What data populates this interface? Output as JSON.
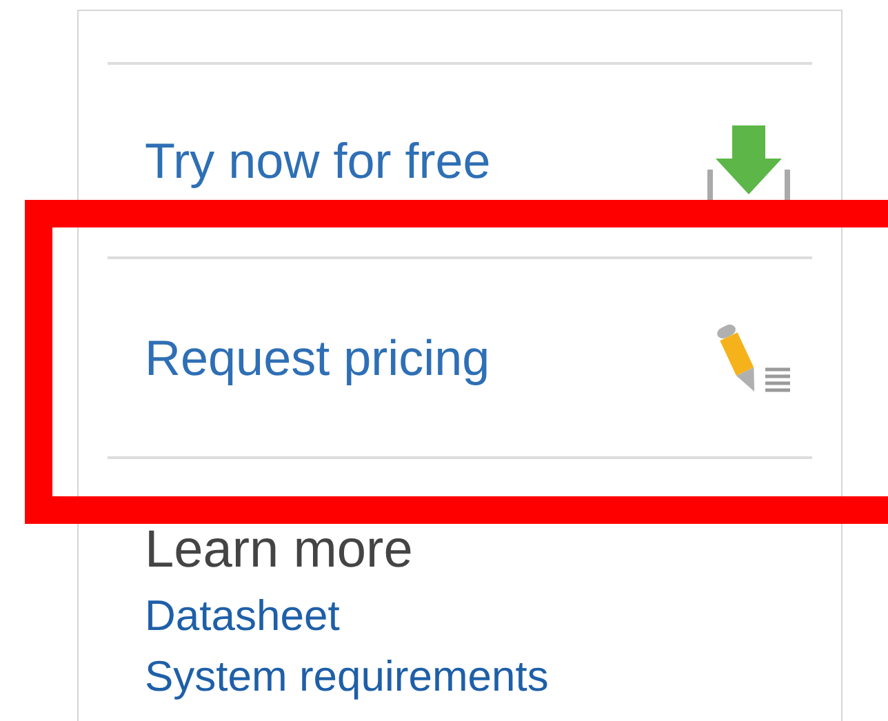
{
  "actions": [
    {
      "kind": "download",
      "label": "Try now for free"
    },
    {
      "kind": "pricing",
      "label": "Request pricing"
    }
  ],
  "learn_more": {
    "title": "Learn more",
    "links": [
      "Datasheet",
      "System requirements"
    ]
  }
}
